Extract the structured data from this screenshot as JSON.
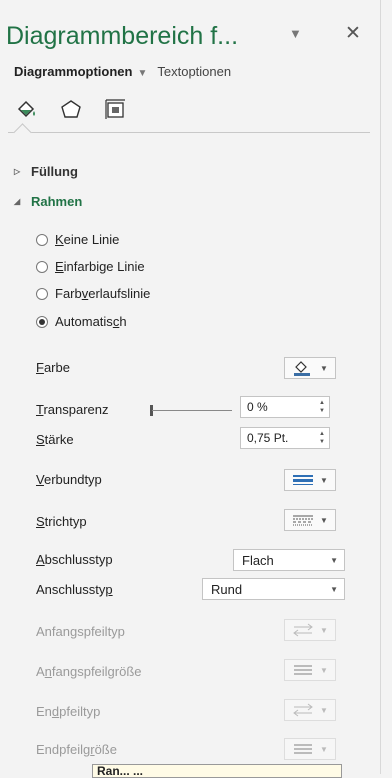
{
  "pane": {
    "title": "Diagrammbereich f...",
    "title_dropdown_icon": "chevron-down-icon",
    "close_icon": "close-icon",
    "subtabs": [
      {
        "label": "Diagrammoptionen",
        "active": true
      },
      {
        "label": "Textoptionen",
        "active": false
      }
    ],
    "icon_tabs": [
      {
        "name": "fill-line-icon",
        "selected": true
      },
      {
        "name": "effects-pentagon-icon",
        "selected": false
      },
      {
        "name": "size-properties-icon",
        "selected": false
      }
    ]
  },
  "sections": {
    "fuellung": {
      "label": "Füllung",
      "expanded": false
    },
    "rahmen": {
      "label": "Rahmen",
      "expanded": true
    }
  },
  "border_options": [
    {
      "pre": "",
      "u": "K",
      "post": "eine Linie",
      "selected": false
    },
    {
      "pre": "",
      "u": "E",
      "post": "infarbige Linie",
      "selected": false
    },
    {
      "pre": "Farb",
      "u": "v",
      "post": "erlaufslinie",
      "selected": false
    },
    {
      "pre": "Automatis",
      "u": "c",
      "post": "h",
      "selected": true
    }
  ],
  "properties": {
    "farbe": {
      "pre": "",
      "u": "F",
      "post": "arbe"
    },
    "transparenz": {
      "pre": "",
      "u": "T",
      "post": "ransparenz",
      "value": "0 %"
    },
    "staerke": {
      "pre": "",
      "u": "S",
      "post": "tärke",
      "value": "0,75 Pt."
    },
    "verbundtyp": {
      "pre": "",
      "u": "V",
      "post": "erbundtyp"
    },
    "strichtyp": {
      "pre": "",
      "u": "S",
      "post": "trichtyp"
    },
    "abschlusstyp": {
      "pre": "",
      "u": "A",
      "post": "bschlusstyp",
      "value": "Flach"
    },
    "anschlusstyp": {
      "pre": "Anschlussty",
      "u": "p",
      "post": "",
      "value": "Rund"
    },
    "anfangspfeiltyp": {
      "pre": "Anfan",
      "u": "g",
      "post": "spfeiltyp"
    },
    "anfangspfeilgroesse": {
      "pre": "A",
      "u": "n",
      "post": "fangspfeilgröße"
    },
    "endpfeiltyp": {
      "pre": "En",
      "u": "d",
      "post": "pfeiltyp"
    },
    "endpfeilgroesse": {
      "pre": "Endpfeilg",
      "u": "r",
      "post": "öße"
    }
  },
  "tooltip": {
    "text": "Ran... ..."
  },
  "colors": {
    "accent": "#217346",
    "disabled": "#9a9a9a"
  }
}
